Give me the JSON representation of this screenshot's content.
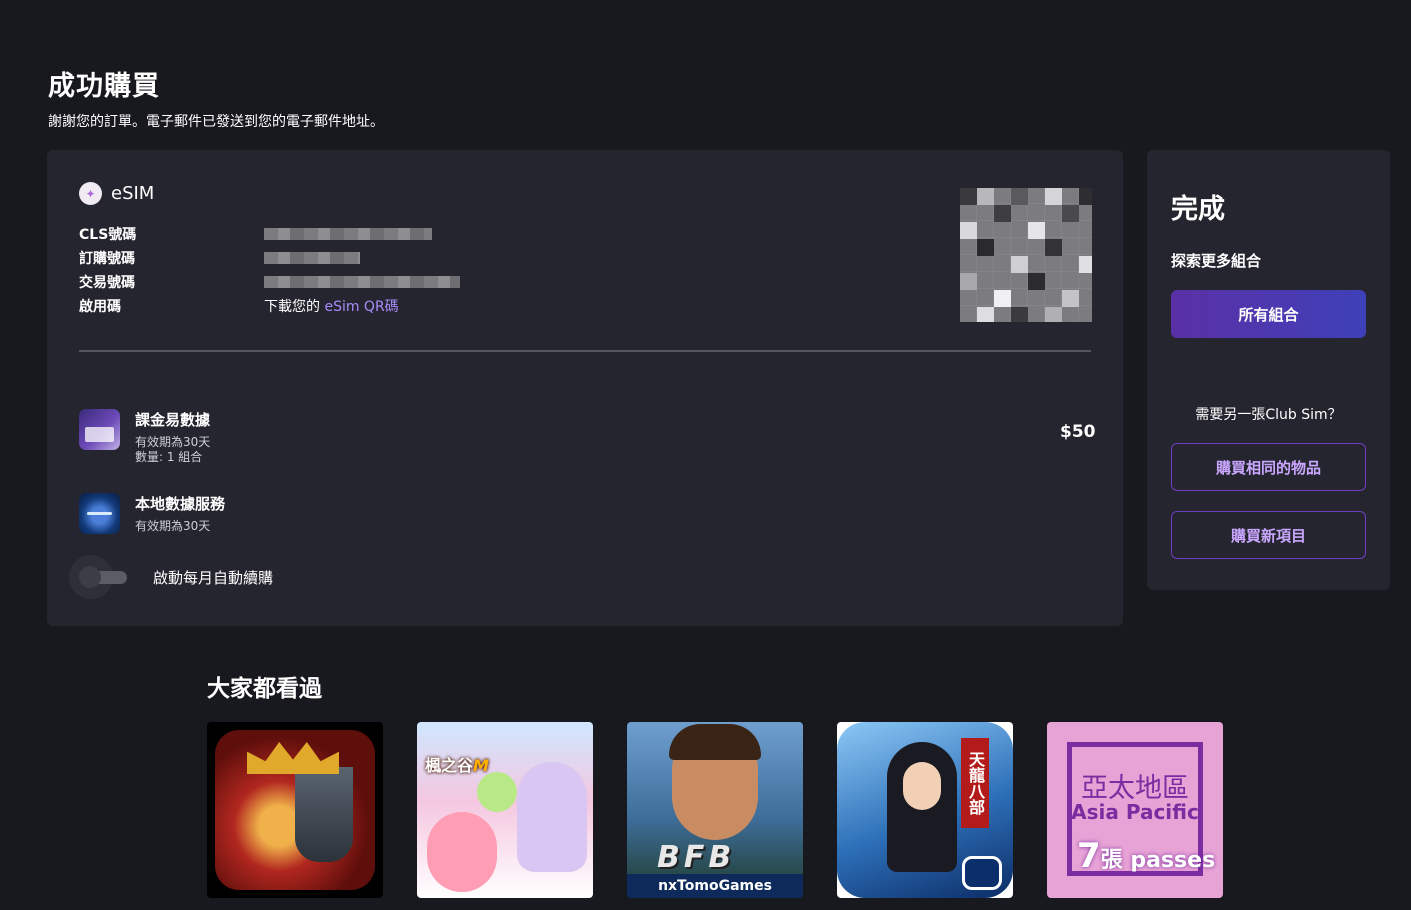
{
  "header": {
    "title": "成功購買",
    "subtitle": "謝謝您的訂單。電子郵件已發送到您的電子郵件地址。"
  },
  "order": {
    "esim_label": "eSIM",
    "rows": [
      {
        "label": "CLS號碼"
      },
      {
        "label": "訂購號碼"
      },
      {
        "label": "交易號碼"
      },
      {
        "label": "啟用碼",
        "prefix": "下載您的 ",
        "link": "eSim QR碼"
      }
    ],
    "products": [
      {
        "name": "課金易數據",
        "validity": "有效期為30天",
        "quantity": "數量: 1 組合"
      },
      {
        "name": "本地數據服務",
        "validity": "有效期為30天"
      }
    ],
    "price": "$50",
    "auto_renew_label": "啟動每月自動續購",
    "auto_renew_on": false
  },
  "side": {
    "title": "完成",
    "explore_label": "探索更多組合",
    "all_bundles_button": "所有組合",
    "question": "需要另一張Club Sim？",
    "buy_same_button": "購買相同的物品",
    "buy_new_button": "購買新項目"
  },
  "recommend": {
    "title": "大家都看過",
    "tiles": [
      {
        "name": "clash-of-kings"
      },
      {
        "name": "maplestory-m",
        "logo": "楓之谷",
        "logo_accent": "M"
      },
      {
        "name": "bfb",
        "logo": "BFB",
        "caption": "nxTomoGames"
      },
      {
        "name": "tianlong-babu",
        "banner": "天龍八部"
      },
      {
        "name": "asia-pacific",
        "cn": "亞太地區",
        "en": "Asia Pacific",
        "count": "7",
        "unit": "張",
        "passes": "passes"
      }
    ]
  },
  "colors": {
    "background": "#18181f",
    "card": "#25252f",
    "accent_purple": "#a78bfa",
    "button_gradient_start": "#5b30a6",
    "button_gradient_end": "#3e40b8",
    "outline": "#6e3fbf"
  }
}
